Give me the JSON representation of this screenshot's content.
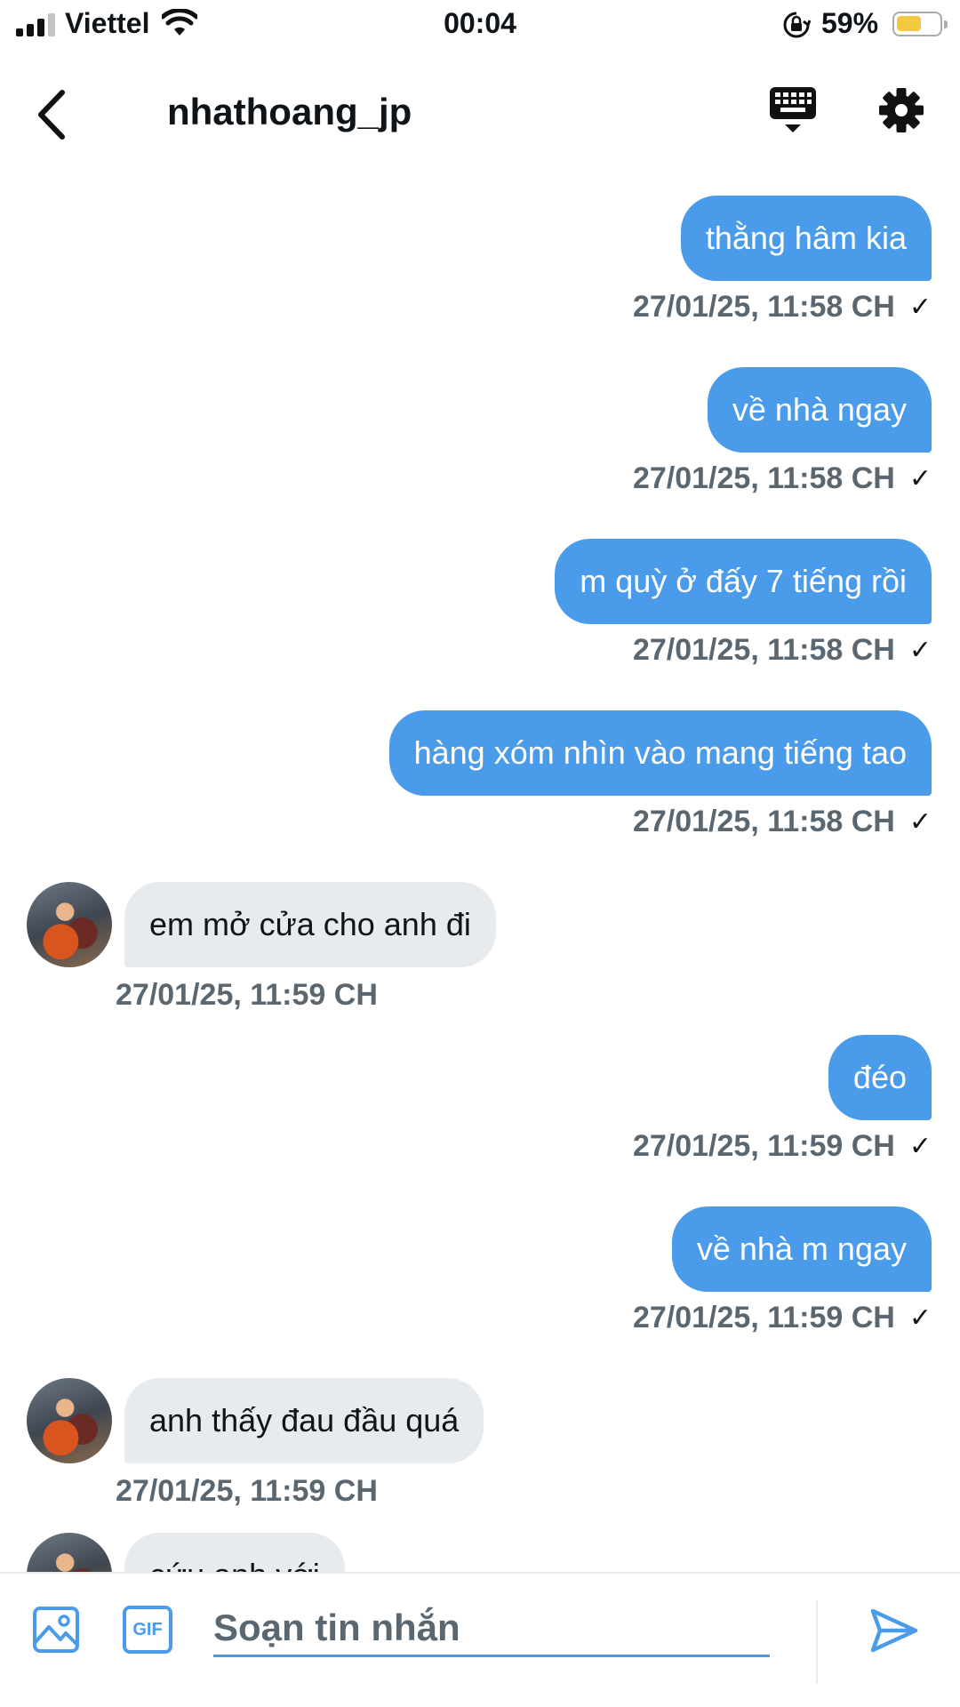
{
  "status_bar": {
    "carrier": "Viettel",
    "time": "00:04",
    "battery_percent": "59%",
    "battery_level": 0.59,
    "battery_color": "#f5c842"
  },
  "header": {
    "title": "nhathoang_jp",
    "back_icon": "chevron-left-icon",
    "keyboard_icon": "keyboard-icon",
    "settings_icon": "gear-icon"
  },
  "messages": [
    {
      "direction": "out",
      "text": "thằng hâm kia",
      "time": "27/01/25, 11:58 CH",
      "read": "✓"
    },
    {
      "direction": "out",
      "text": "về nhà ngay",
      "time": "27/01/25, 11:58 CH",
      "read": "✓"
    },
    {
      "direction": "out",
      "text": "m quỳ ở đấy 7 tiếng rồi",
      "time": "27/01/25, 11:58 CH",
      "read": "✓"
    },
    {
      "direction": "out",
      "text": "hàng xóm nhìn vào mang tiếng tao",
      "time": "27/01/25, 11:58 CH",
      "read": "✓"
    },
    {
      "direction": "in",
      "text": "em mở cửa cho anh đi",
      "time": "27/01/25, 11:59 CH"
    },
    {
      "direction": "out",
      "text": "đéo",
      "time": "27/01/25, 11:59 CH",
      "read": "✓"
    },
    {
      "direction": "out",
      "text": "về nhà m ngay",
      "time": "27/01/25, 11:59 CH",
      "read": "✓"
    },
    {
      "direction": "in",
      "text": "anh thấy đau đầu quá",
      "time": "27/01/25, 11:59 CH"
    },
    {
      "direction": "in",
      "text": "cứu anh với",
      "time": ""
    }
  ],
  "composer": {
    "placeholder": "Soạn tin nhắn",
    "gif_label": "GIF",
    "image_icon": "image-icon",
    "send_icon": "send-icon"
  },
  "colors": {
    "accent": "#4a9be9",
    "incoming_bubble": "#e8ebee",
    "timestamp": "#5b6770"
  }
}
